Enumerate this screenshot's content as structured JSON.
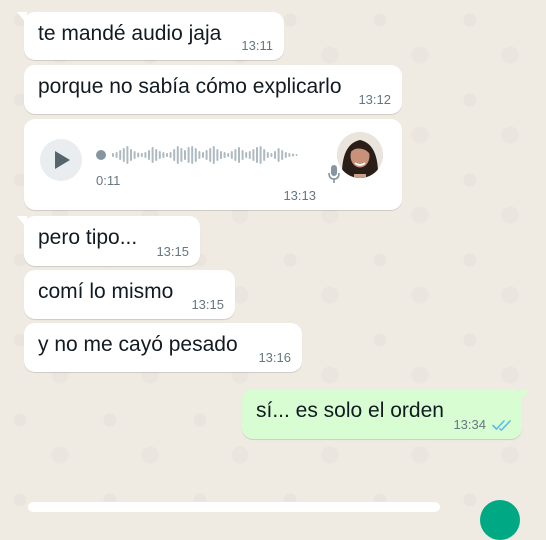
{
  "messages": [
    {
      "text": "te mandé audio jaja",
      "time": "13:11"
    },
    {
      "text": "porque no sabía cómo explicarlo",
      "time": "13:12"
    },
    {
      "type": "voice",
      "duration": "0:11",
      "time": "13:13"
    },
    {
      "text": "pero tipo...",
      "time": "13:15"
    },
    {
      "text": "comí lo mismo",
      "time": "13:15"
    },
    {
      "text": "y no me cayó pesado",
      "time": "13:16"
    },
    {
      "text": "sí... es solo el orden",
      "time": "13:34",
      "status": "read"
    }
  ],
  "icons": {
    "play": "play-icon",
    "mic": "mic-icon",
    "read_ticks": "double-check-icon"
  },
  "colors": {
    "background": "#efeae2",
    "incoming_bubble": "#ffffff",
    "outgoing_bubble": "#d9fdd3",
    "read_ticks": "#53bdeb",
    "accent": "#00a884"
  }
}
